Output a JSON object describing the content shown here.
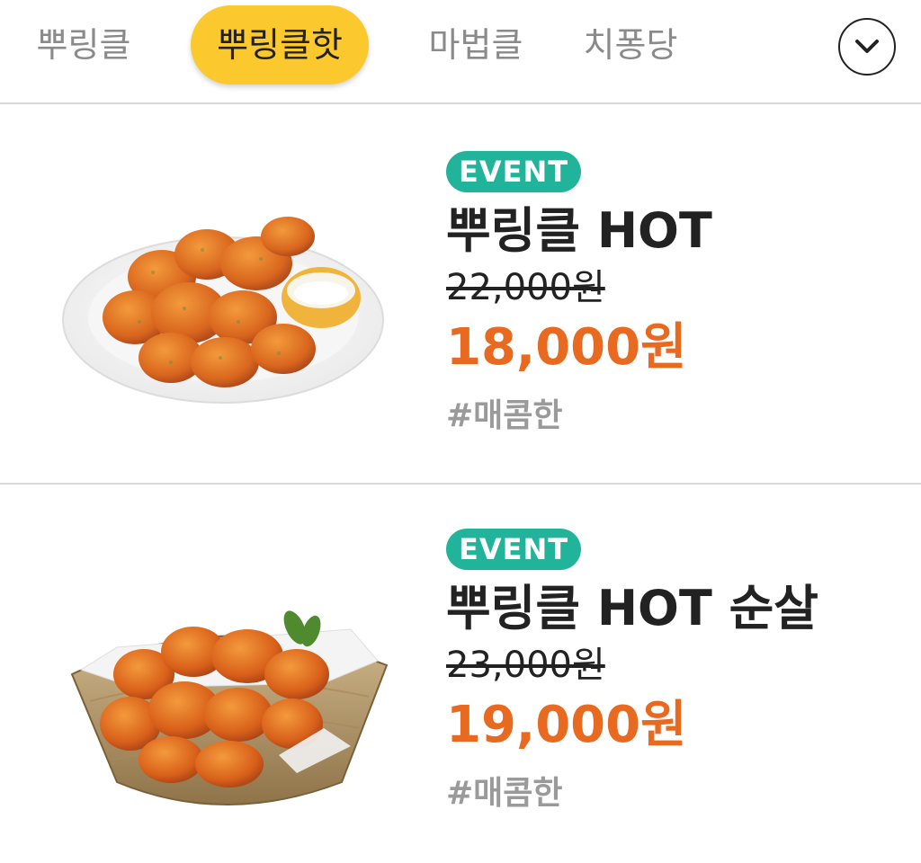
{
  "tabs": [
    {
      "label": "뿌링클",
      "active": false
    },
    {
      "label": "뿌링클핫",
      "active": true
    },
    {
      "label": "마법클",
      "active": false
    },
    {
      "label": "치퐁당",
      "active": false
    }
  ],
  "expand_button": {
    "icon": "chevron-down-icon"
  },
  "colors": {
    "tab_active_bg": "#fbc92e",
    "badge_bg": "#22b39b",
    "sale_price": "#e86a21",
    "tag_text": "#9a9a9a"
  },
  "menu_items": [
    {
      "badge": "EVENT",
      "name": "뿌링클 HOT",
      "original_price": "22,000원",
      "sale_price": "18,000원",
      "tag": "#매콤한",
      "image": "chicken-on-plate-with-sauce"
    },
    {
      "badge": "EVENT",
      "name": "뿌링클 HOT 순살",
      "original_price": "23,000원",
      "sale_price": "19,000원",
      "tag": "#매콤한",
      "image": "boneless-chicken-in-basket"
    }
  ]
}
